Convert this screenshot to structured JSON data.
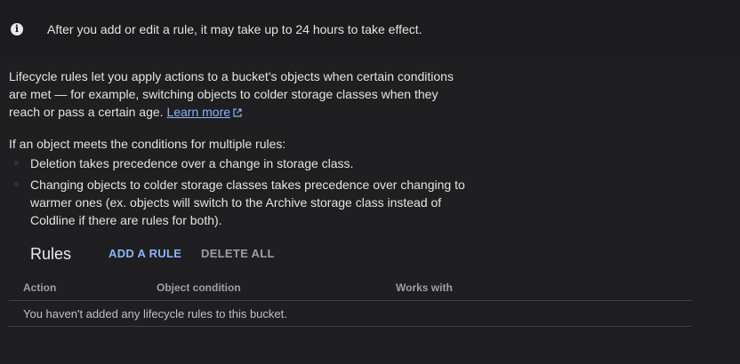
{
  "info_banner": {
    "icon": "info-icon",
    "text": "After you add or edit a rule, it may take up to 24 hours to take effect."
  },
  "intro": {
    "text": "Lifecycle rules let you apply actions to a bucket's objects when certain conditions are met — for example, switching objects to colder storage classes when they reach or pass a certain age.",
    "learn_more_label": "Learn more",
    "learn_more_icon": "open-in-new-icon"
  },
  "conditions": {
    "title": "If an object meets the conditions for multiple rules:",
    "items": [
      "Deletion takes precedence over a change in storage class.",
      "Changing objects to colder storage classes takes precedence over changing to warmer ones (ex. objects will switch to the Archive storage class instead of Coldline if there are rules for both)."
    ]
  },
  "rules": {
    "title": "Rules",
    "add_label": "ADD A RULE",
    "delete_all_label": "DELETE ALL",
    "columns": [
      "Action",
      "Object condition",
      "Works with"
    ],
    "empty_message": "You haven't added any lifecycle rules to this bucket."
  },
  "colors": {
    "background": "#1f1f21",
    "text": "#e3e3e3",
    "link": "#8ab4f8",
    "muted": "#9aa0a6",
    "divider": "#3c4043"
  }
}
